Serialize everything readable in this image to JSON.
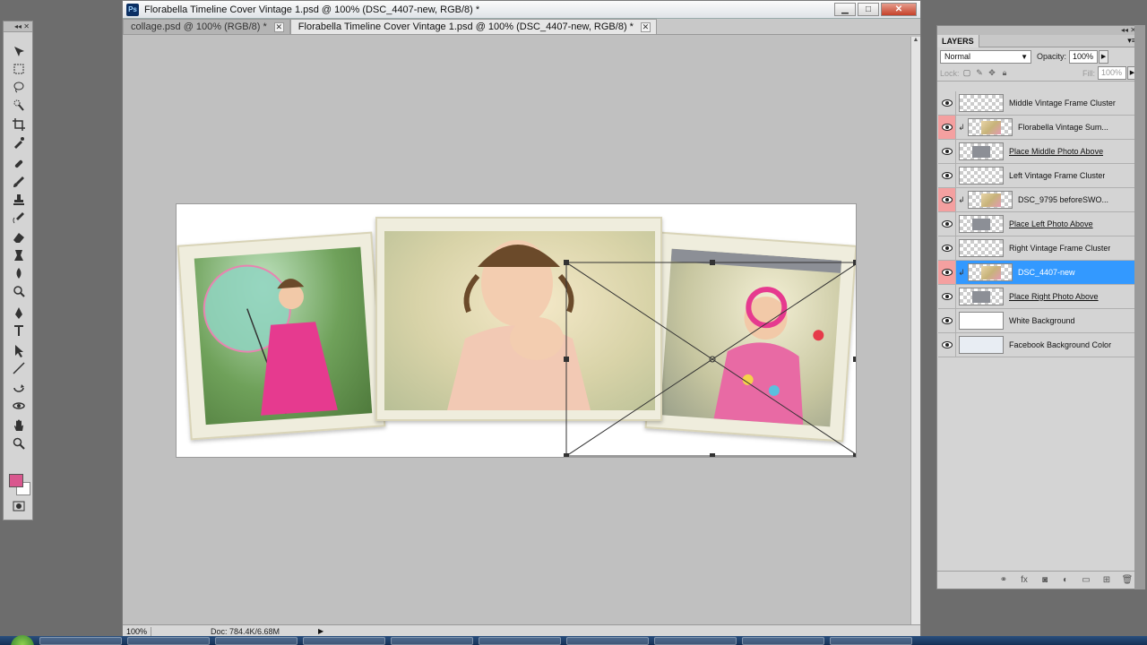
{
  "window": {
    "title": "Florabella Timeline Cover Vintage 1.psd @ 100% (DSC_4407-new, RGB/8) *",
    "minimize": "▁",
    "maximize": "□",
    "close": "✕"
  },
  "tabs": [
    {
      "label": "collage.psd @ 100% (RGB/8) *",
      "active": false
    },
    {
      "label": "Florabella Timeline Cover Vintage 1.psd @ 100% (DSC_4407-new, RGB/8) *",
      "active": true
    }
  ],
  "status": {
    "zoom": "100%",
    "doc_info": "Doc: 784.4K/6.68M"
  },
  "colors": {
    "foreground": "#d9578e",
    "background": "#ffffff",
    "selection": "#3399ff"
  },
  "tools": [
    "move-tool-icon",
    "marquee-tool-icon",
    "lasso-tool-icon",
    "quick-select-tool-icon",
    "crop-tool-icon",
    "eyedropper-tool-icon",
    "healing-brush-icon",
    "brush-tool-icon",
    "clone-stamp-icon",
    "history-brush-icon",
    "eraser-tool-icon",
    "gradient-tool-icon",
    "blur-tool-icon",
    "dodge-tool-icon",
    "pen-tool-icon",
    "type-tool-icon",
    "path-select-icon",
    "line-tool-icon",
    "3d-rotate-icon",
    "3d-orbit-icon",
    "hand-tool-icon",
    "zoom-tool-icon"
  ],
  "layers_panel": {
    "title": "LAYERS",
    "blend_mode": "Normal",
    "opacity_label": "Opacity:",
    "opacity_value": "100%",
    "lock_label": "Lock:",
    "fill_label": "Fill:",
    "fill_value": "100%",
    "layers": [
      {
        "name": "Middle Vintage Frame Cluster",
        "clipped": false,
        "thumb": "checker",
        "underline": false,
        "selected": false,
        "eye_red": false
      },
      {
        "name": "Florabella Vintage Sum...",
        "clipped": true,
        "thumb": "photo",
        "underline": false,
        "selected": false,
        "eye_red": true
      },
      {
        "name": "Place Middle Photo Above",
        "clipped": false,
        "thumb": "gray",
        "underline": true,
        "selected": false,
        "eye_red": false
      },
      {
        "name": "Left Vintage Frame Cluster",
        "clipped": false,
        "thumb": "checker",
        "underline": false,
        "selected": false,
        "eye_red": false
      },
      {
        "name": "DSC_9795 beforeSWO...",
        "clipped": true,
        "thumb": "photo",
        "underline": false,
        "selected": false,
        "eye_red": true
      },
      {
        "name": "Place Left Photo Above",
        "clipped": false,
        "thumb": "gray",
        "underline": true,
        "selected": false,
        "eye_red": false
      },
      {
        "name": "Right Vintage Frame Cluster",
        "clipped": false,
        "thumb": "checker",
        "underline": false,
        "selected": false,
        "eye_red": false
      },
      {
        "name": "DSC_4407-new",
        "clipped": true,
        "thumb": "photo",
        "underline": false,
        "selected": true,
        "eye_red": true
      },
      {
        "name": "Place Right Photo Above",
        "clipped": false,
        "thumb": "gray",
        "underline": true,
        "selected": false,
        "eye_red": false
      },
      {
        "name": "White Background",
        "clipped": false,
        "thumb": "white",
        "underline": false,
        "selected": false,
        "eye_red": false
      },
      {
        "name": "Facebook Background Color",
        "clipped": false,
        "thumb": "lightblue",
        "underline": false,
        "selected": false,
        "eye_red": false
      }
    ]
  }
}
